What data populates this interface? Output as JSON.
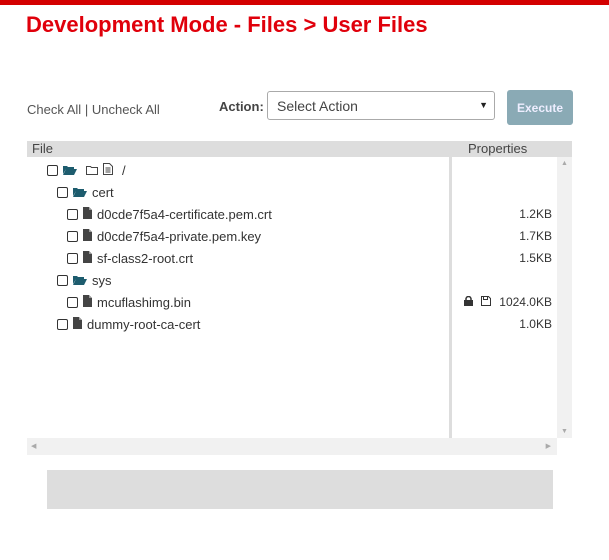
{
  "title": "Development Mode - Files > User Files",
  "check_all": "Check All",
  "separator": "|",
  "uncheck_all": "Uncheck All",
  "action_label": "Action:",
  "action_select": "Select Action",
  "execute": "Execute",
  "columns": {
    "file": "File",
    "properties": "Properties"
  },
  "root": "/",
  "tree": [
    {
      "name": "cert",
      "type": "folder",
      "size": ""
    },
    {
      "name": "d0cde7f5a4-certificate.pem.crt",
      "type": "file",
      "size": "1.2KB"
    },
    {
      "name": "d0cde7f5a4-private.pem.key",
      "type": "file",
      "size": "1.7KB"
    },
    {
      "name": "sf-class2-root.crt",
      "type": "file",
      "size": "1.5KB"
    },
    {
      "name": "sys",
      "type": "folder",
      "size": ""
    },
    {
      "name": "mcuflashimg.bin",
      "type": "file",
      "size": "1024.0KB",
      "locked": true
    },
    {
      "name": "dummy-root-ca-cert",
      "type": "file",
      "size": "1.0KB"
    }
  ],
  "colors": {
    "accent": "#e0000b",
    "folder": "#1d5c6e",
    "execute": "#8aaab5"
  }
}
